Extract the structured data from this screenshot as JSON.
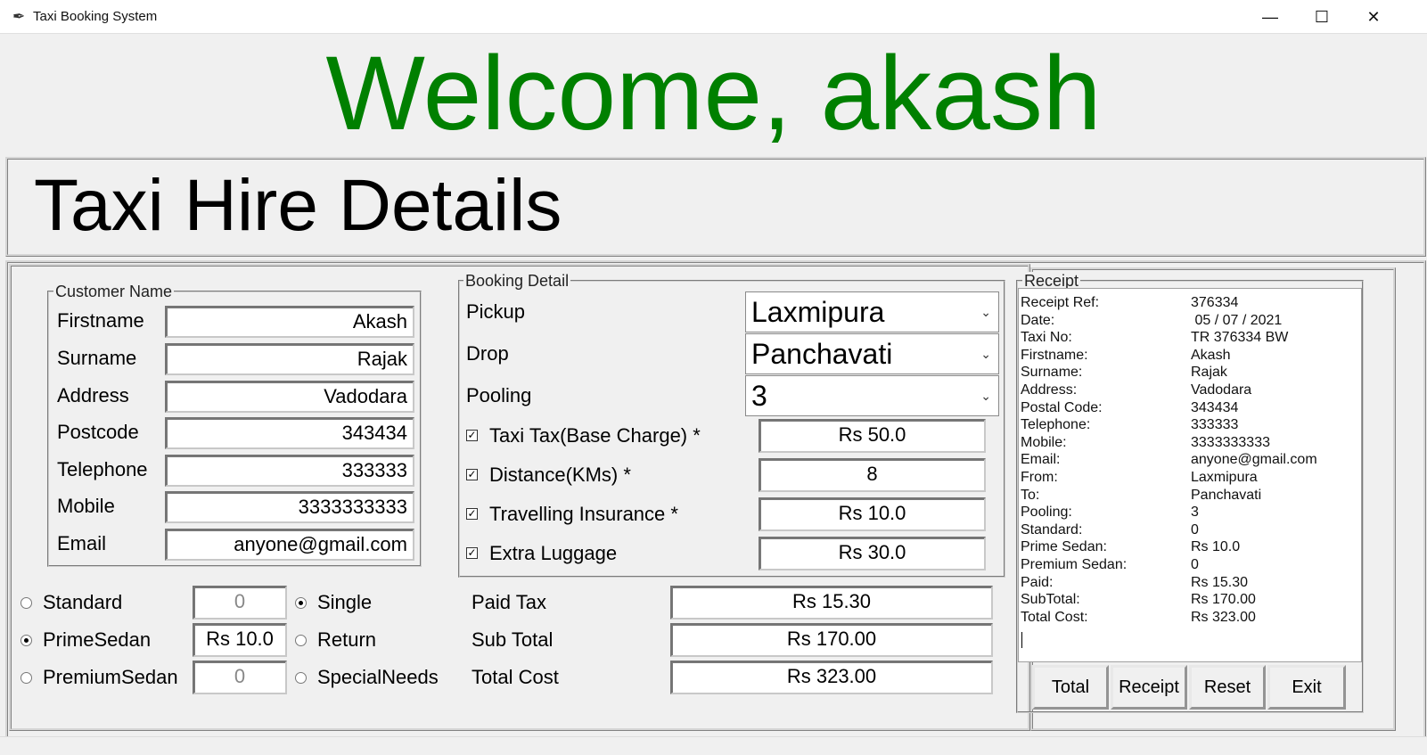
{
  "window": {
    "title": "Taxi Booking System",
    "minimize_glyph": "—",
    "maximize_glyph": "☐",
    "close_glyph": "✕",
    "app_icon": "feather-icon"
  },
  "welcome": "Welcome, akash",
  "header": "Taxi Hire Details",
  "customer": {
    "group_label": "Customer Name",
    "fields": [
      {
        "label": "Firstname",
        "value": "Akash"
      },
      {
        "label": "Surname",
        "value": "Rajak"
      },
      {
        "label": "Address",
        "value": "Vadodara"
      },
      {
        "label": "Postcode",
        "value": "343434"
      },
      {
        "label": "Telephone",
        "value": "333333"
      },
      {
        "label": "Mobile",
        "value": "3333333333"
      },
      {
        "label": "Email",
        "value": "anyone@gmail.com"
      }
    ]
  },
  "booking": {
    "group_label": "Booking Detail",
    "pickup": {
      "label": "Pickup",
      "value": "Laxmipura"
    },
    "drop": {
      "label": "Drop",
      "value": "Panchavati"
    },
    "pooling": {
      "label": "Pooling",
      "value": "3"
    },
    "checks": [
      {
        "label": "Taxi Tax(Base Charge) *",
        "value": "Rs 50.0",
        "checked": true
      },
      {
        "label": "Distance(KMs) *",
        "value": "8",
        "checked": true
      },
      {
        "label": "Travelling Insurance *",
        "value": "Rs 10.0",
        "checked": true
      },
      {
        "label": "Extra Luggage",
        "value": "Rs 30.0",
        "checked": true
      }
    ],
    "check_glyph": "✓",
    "dropdown_glyph": "⌄"
  },
  "car_types": [
    {
      "label": "Standard",
      "value": "0",
      "selected": false
    },
    {
      "label": "PrimeSedan",
      "value": "Rs 10.0",
      "selected": true
    },
    {
      "label": "PremiumSedan",
      "value": "0",
      "selected": false
    }
  ],
  "journey_types": [
    {
      "label": "Single",
      "selected": true
    },
    {
      "label": "Return",
      "selected": false
    },
    {
      "label": "SpecialNeeds",
      "selected": false
    }
  ],
  "totals": [
    {
      "label": "Paid Tax",
      "value": "Rs 15.30"
    },
    {
      "label": "Sub Total",
      "value": "Rs 170.00"
    },
    {
      "label": "Total Cost",
      "value": "Rs 323.00"
    }
  ],
  "receipt": {
    "group_label": "Receipt",
    "rows": [
      {
        "key": "Receipt Ref:",
        "value": "376334"
      },
      {
        "key": "Date:",
        "value": " 05 / 07 / 2021"
      },
      {
        "key": "Taxi No:",
        "value": "TR 376334 BW"
      },
      {
        "key": "Firstname:",
        "value": "Akash"
      },
      {
        "key": "Surname:",
        "value": "Rajak"
      },
      {
        "key": "Address:",
        "value": "Vadodara"
      },
      {
        "key": "Postal Code:",
        "value": "343434"
      },
      {
        "key": "Telephone:",
        "value": "333333"
      },
      {
        "key": "Mobile:",
        "value": "3333333333"
      },
      {
        "key": "Email:",
        "value": "anyone@gmail.com"
      },
      {
        "key": "From:",
        "value": "Laxmipura"
      },
      {
        "key": "To:",
        "value": "Panchavati"
      },
      {
        "key": "Pooling:",
        "value": "3"
      },
      {
        "key": "Standard:",
        "value": "0"
      },
      {
        "key": "Prime Sedan:",
        "value": "Rs 10.0"
      },
      {
        "key": "Premium Sedan:",
        "value": "0"
      },
      {
        "key": "Paid:",
        "value": "Rs 15.30"
      },
      {
        "key": "SubTotal:",
        "value": "Rs 170.00"
      },
      {
        "key": "Total Cost:",
        "value": "Rs 323.00"
      }
    ]
  },
  "buttons": {
    "total": "Total",
    "receipt": "Receipt",
    "reset": "Reset",
    "exit": "Exit"
  },
  "colors": {
    "welcome": "#008000",
    "background": "#f0f0f0"
  }
}
